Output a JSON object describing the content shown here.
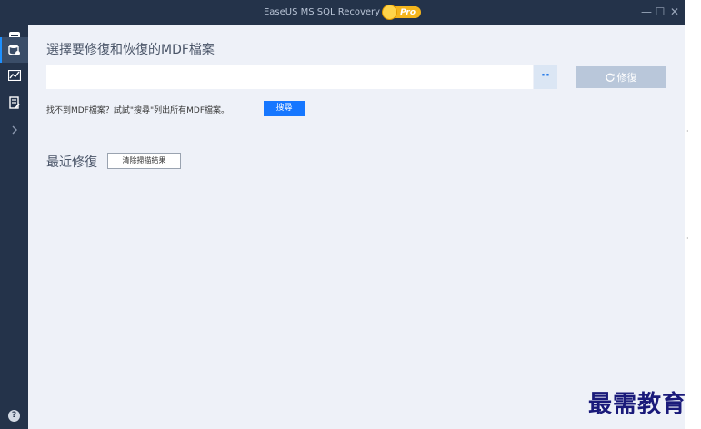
{
  "window": {
    "title": "EaseUS MS SQL Recovery",
    "badge": "Pro",
    "colors": {
      "titlebar": "#24334a",
      "content": "#eef1f8",
      "accent": "#1677ff"
    }
  },
  "window_controls": {
    "minimize": "—",
    "maximize": "☐",
    "close": "✕"
  },
  "sidebar": {
    "items": [
      {
        "icon": "database-repair-icon",
        "active": true
      },
      {
        "icon": "chart-icon",
        "active": false
      },
      {
        "icon": "log-icon",
        "active": false
      },
      {
        "icon": "chevron-right-icon",
        "active": false
      }
    ],
    "help": "?"
  },
  "main": {
    "select_title": "選擇要修復和恢復的MDF檔案",
    "path_input": {
      "value": "",
      "placeholder": ""
    },
    "browse_label": "··",
    "repair_label": "修復",
    "hint": "找不到MDF檔案？試試\"搜尋\"列出所有MDF檔案。",
    "search_label": "搜尋",
    "recent_title": "最近修復",
    "clear_label": "清除掃描結果"
  },
  "watermark": "最需教育"
}
